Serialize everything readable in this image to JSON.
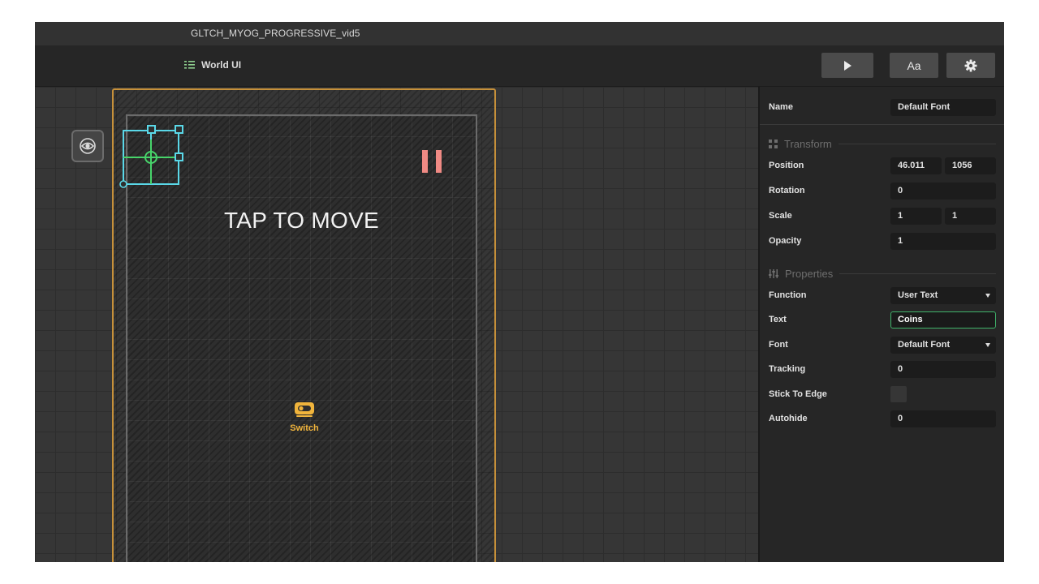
{
  "window": {
    "title": "GLTCH_MYOG_PROGRESSIVE_vid5"
  },
  "toolbar": {
    "scene_tab_label": "World UI",
    "scene_tab_icon": "list-icon",
    "play_icon": "play-icon",
    "font_button_label": "Aa",
    "settings_icon": "gear-icon"
  },
  "canvas": {
    "visibility_icon": "eye-icon",
    "tap_text": "TAP TO MOVE",
    "pause_icon": "pause-icon",
    "pause_color": "#f08a84",
    "switch_label": "Switch",
    "switch_icon": "toggle-icon",
    "switch_color": "#f0b43c",
    "safe_area_color": "#c6903a",
    "gizmo_color": "#5ad8e8",
    "gizmo_center_color": "#47d46a"
  },
  "inspector": {
    "name_label": "Name",
    "name_value": "Default Font",
    "transform_title": "Transform",
    "position_label": "Position",
    "position_x": "46.011",
    "position_y": "1056",
    "rotation_label": "Rotation",
    "rotation_value": "0",
    "scale_label": "Scale",
    "scale_x": "1",
    "scale_y": "1",
    "opacity_label": "Opacity",
    "opacity_value": "1",
    "properties_title": "Properties",
    "function_label": "Function",
    "function_value": "User Text",
    "text_label": "Text",
    "text_value": "Coins",
    "font_label": "Font",
    "font_value": "Default Font",
    "tracking_label": "Tracking",
    "tracking_value": "0",
    "stick_label": "Stick To Edge",
    "stick_checked": false,
    "autohide_label": "Autohide",
    "autohide_value": "0",
    "active_field_color": "#3fb36a"
  }
}
